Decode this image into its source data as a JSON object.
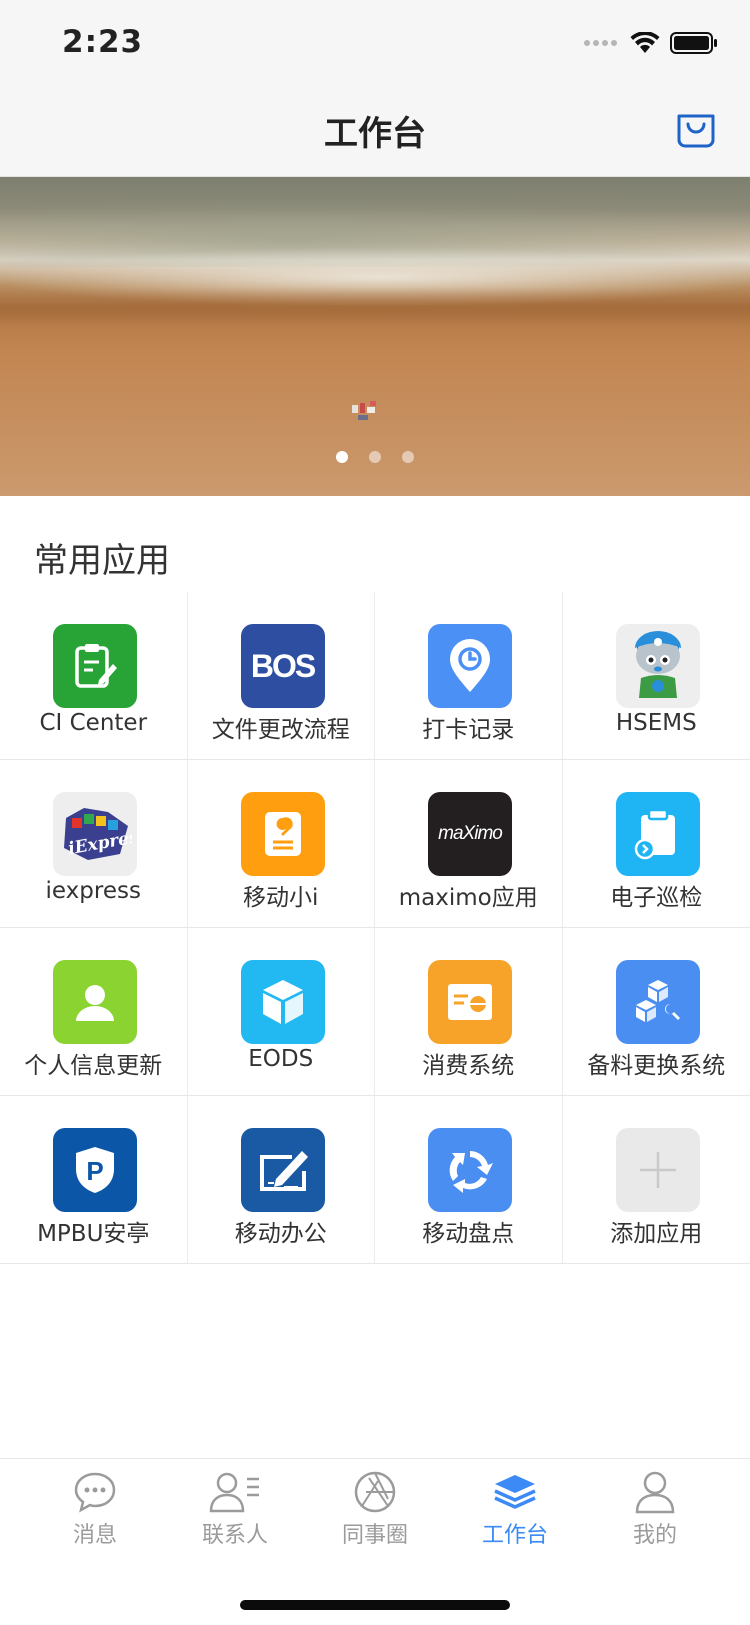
{
  "status_bar": {
    "time": "2:23"
  },
  "navbar": {
    "title": "工作台"
  },
  "banner": {
    "active_page": 1,
    "page_count": 3
  },
  "section": {
    "title": "常用应用"
  },
  "apps": [
    {
      "label": "CI Center",
      "icon": "clipboard-edit-icon",
      "color": "#28a436"
    },
    {
      "label": "文件更改流程",
      "icon": "bos-logo-icon",
      "icon_text": "BOS",
      "color": "#2e4ea2"
    },
    {
      "label": "打卡记录",
      "icon": "location-clock-icon",
      "color": "#4a90f5"
    },
    {
      "label": "HSEMS",
      "icon": "mascot-icon",
      "color": "#eeeeee"
    },
    {
      "label": "iexpress",
      "icon": "iexpress-logo-icon",
      "color": "#eeeeee"
    },
    {
      "label": "移动小i",
      "icon": "wrench-note-icon",
      "color": "#ff9f0f"
    },
    {
      "label": "maximo应用",
      "icon": "maximo-logo-icon",
      "icon_text": "maXimo",
      "color": "#231f20"
    },
    {
      "label": "电子巡检",
      "icon": "clipboard-arrow-icon",
      "color": "#1fb5f4"
    },
    {
      "label": "个人信息更新",
      "icon": "person-icon",
      "color": "#8ad330"
    },
    {
      "label": "EODS",
      "icon": "cube-icon",
      "color": "#22b8f2"
    },
    {
      "label": "消费系统",
      "icon": "card-icon",
      "color": "#f7a32a"
    },
    {
      "label": "备料更换系统",
      "icon": "boxes-wrench-icon",
      "color": "#4b8ef2"
    },
    {
      "label": "MPBU安亭",
      "icon": "parking-shield-icon",
      "icon_text": "P",
      "color": "#0c56a8"
    },
    {
      "label": "移动办公",
      "icon": "pen-doc-icon",
      "color": "#1a5aa5"
    },
    {
      "label": "移动盘点",
      "icon": "recycle-icon",
      "color": "#4b8ef2"
    },
    {
      "label": "添加应用",
      "icon": "plus-icon",
      "color": "#e9e9e9"
    }
  ],
  "tabs": [
    {
      "label": "消息",
      "icon": "chat-bubble-icon",
      "active": false
    },
    {
      "label": "联系人",
      "icon": "contacts-icon",
      "active": false
    },
    {
      "label": "同事圈",
      "icon": "aperture-icon",
      "active": false
    },
    {
      "label": "工作台",
      "icon": "layers-icon",
      "active": true
    },
    {
      "label": "我的",
      "icon": "user-icon",
      "active": false
    }
  ],
  "colors": {
    "accent": "#3b8af5",
    "tab_inactive": "#9b9b9b"
  }
}
